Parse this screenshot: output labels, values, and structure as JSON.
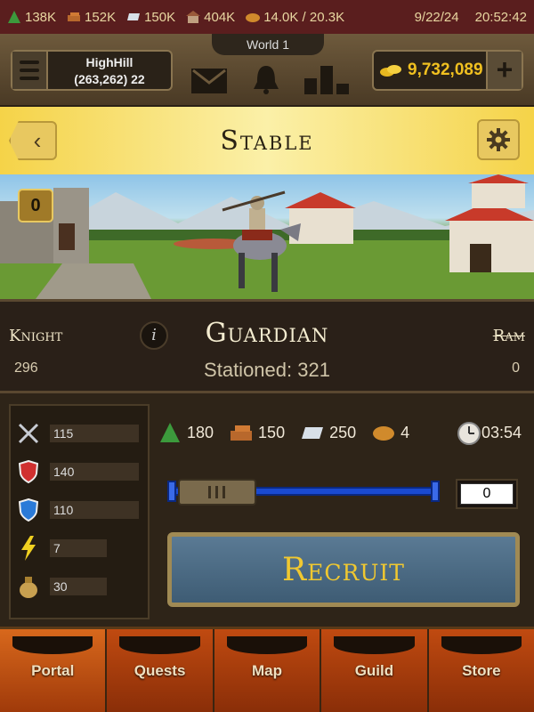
{
  "status_bar": {
    "wood": "138K",
    "clay": "152K",
    "iron": "150K",
    "population": "404K",
    "food": "14.0K / 20.3K",
    "date": "9/22/24",
    "time": "20:52:42"
  },
  "header": {
    "world_label": "World 1",
    "player_name": "HighHill",
    "player_coords": "(263,262) 22",
    "gold": "9,732,089",
    "plus_label": "+"
  },
  "title_bar": {
    "title": "Stable",
    "back_label": "‹"
  },
  "scene": {
    "badge_count": "0"
  },
  "unit": {
    "prev_name": "Knight",
    "prev_count": "296",
    "info_label": "i",
    "name": "Guardian",
    "stationed": "Stationed: 321",
    "next_name": "Ram",
    "next_count": "0"
  },
  "stats": {
    "attack": "115",
    "defense_red": "140",
    "defense_blue": "110",
    "speed": "7",
    "capacity": "30"
  },
  "costs": {
    "wood": "180",
    "clay": "150",
    "iron": "250",
    "food": "4",
    "time": "03:54"
  },
  "recruit": {
    "quantity": "0",
    "slider_fraction": 0,
    "button_label": "Recruit"
  },
  "nav": {
    "items": [
      {
        "label": "Portal"
      },
      {
        "label": "Quests"
      },
      {
        "label": "Map"
      },
      {
        "label": "Guild"
      },
      {
        "label": "Store"
      }
    ]
  },
  "colors": {
    "gold_text": "#f0c020",
    "recruit_text": "#f0c830",
    "banner": "#f5d348"
  }
}
